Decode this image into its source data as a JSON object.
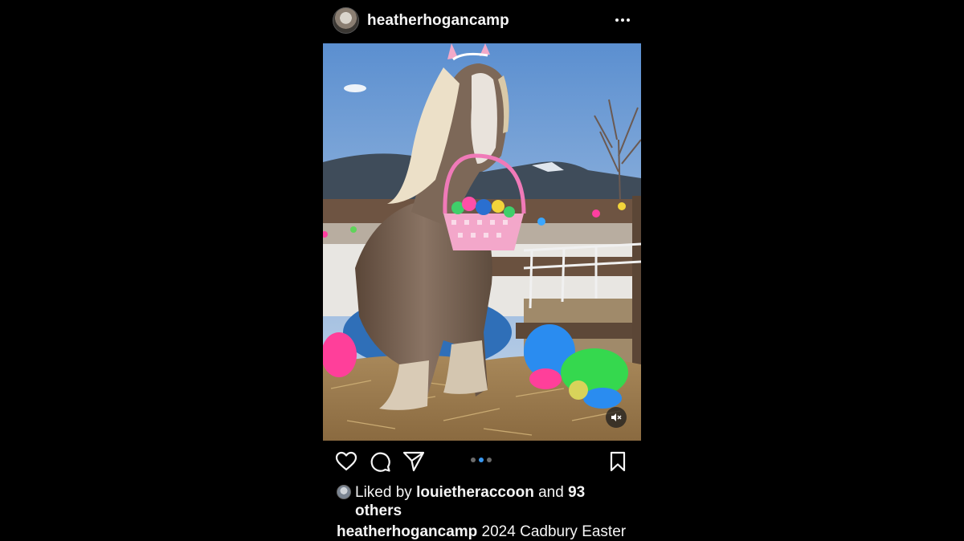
{
  "post": {
    "username": "heatherhogancamp",
    "avatar_icon": "profile-avatar",
    "more_icon": "more-horizontal-icon",
    "media": {
      "description_icon": "horse-with-easter-basket-photo",
      "mute_icon": "volume-muted-icon"
    },
    "actions": {
      "like_icon": "heart-icon",
      "comment_icon": "comment-bubble-icon",
      "share_icon": "paper-plane-icon",
      "save_icon": "bookmark-icon",
      "carousel_count": 3,
      "carousel_active": 2
    },
    "likes": {
      "prefix": "Liked by",
      "liker": "louietheraccoon",
      "conjunction": "and",
      "count": "93",
      "suffix": "others"
    },
    "caption": {
      "username": "heatherhogancamp",
      "text": "2024 Cadbury Easter"
    },
    "colors": {
      "background": "#000000",
      "text": "#f5f5f5",
      "carousel_active": "#3897f0"
    }
  }
}
